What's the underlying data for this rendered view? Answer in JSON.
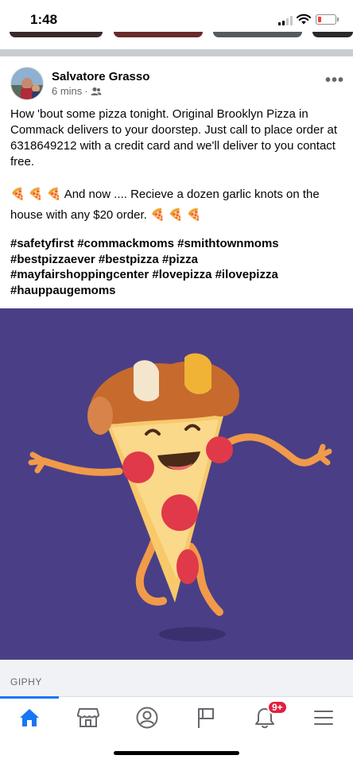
{
  "status_bar": {
    "time": "1:48",
    "signal_icon": "cellular-signal-icon",
    "wifi_icon": "wifi-icon",
    "battery_icon": "battery-low-icon",
    "battery_color": "#ff3b30"
  },
  "post": {
    "author": "Salvatore Grasso",
    "time_ago": "6 mins",
    "separator": "·",
    "audience_icon": "friends-icon",
    "more_icon": "more-options-icon",
    "more_label": "•••",
    "text_paragraph_1": "How 'bout some pizza tonight.  Original Brooklyn Pizza in Commack delivers to your doorstep.  Just call to place order at 6318649212 with a credit card and we'll deliver to you contact free.",
    "text_paragraph_2_lead": "🍕 🍕  🍕   And now .... Recieve a dozen garlic knots on the house with any $20 order.",
    "text_paragraph_2_tail": "  🍕 🍕 🍕",
    "hashtags": [
      "#safetyfirst",
      "#commackmoms",
      "#smithtownmoms",
      "#bestpizzaever",
      "#bestpizza",
      "#pizza",
      "#mayfairshoppingcenter",
      "#lovepizza",
      "#ilovepizza",
      "#hauppaugemoms"
    ],
    "image_background": "#4a3f86",
    "attachment_source": "GIPHY"
  },
  "tab_bar": {
    "tabs": [
      {
        "name": "home",
        "icon": "home-icon",
        "active": true
      },
      {
        "name": "marketplace",
        "icon": "marketplace-icon",
        "active": false
      },
      {
        "name": "profile",
        "icon": "profile-icon",
        "active": false
      },
      {
        "name": "pages",
        "icon": "flag-icon",
        "active": false
      },
      {
        "name": "notifications",
        "icon": "bell-icon",
        "active": false,
        "badge": "9+"
      },
      {
        "name": "menu",
        "icon": "menu-icon",
        "active": false
      }
    ],
    "accent_color": "#1877f2",
    "badge_color": "#e41e3f"
  }
}
